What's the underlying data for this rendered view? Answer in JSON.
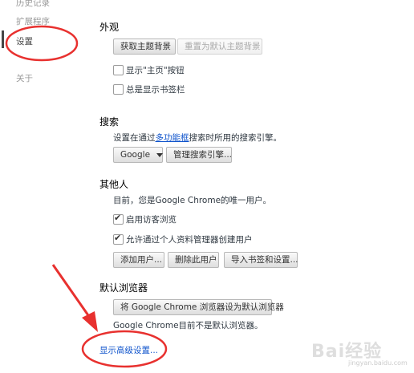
{
  "sidebar": {
    "items": [
      {
        "label": "历史记录"
      },
      {
        "label": "扩展程序"
      },
      {
        "label": "设置"
      },
      {
        "label": "关于"
      }
    ]
  },
  "appearance": {
    "title": "外观",
    "get_themes": "获取主题背景",
    "reset_theme": "重置为默认主题背景",
    "show_home": "显示\"主页\"按钮",
    "show_bookmarks": "总是显示书签栏"
  },
  "search": {
    "title": "搜索",
    "desc_prefix": "设置在通过",
    "desc_link": "多功能框",
    "desc_suffix": "搜索时所用的搜索引擎。",
    "engine": "Google",
    "manage": "管理搜索引擎..."
  },
  "people": {
    "title": "其他人",
    "desc": "目前，您是Google Chrome的唯一用户。",
    "guest": "启用访客浏览",
    "allow_create": "允许通过个人资料管理器创建用户",
    "add_user": "添加用户...",
    "delete_user": "删除此用户",
    "import": "导入书签和设置..."
  },
  "default_browser": {
    "title": "默认浏览器",
    "set_button": "将 Google Chrome 浏览器设为默认浏览器",
    "status": "Google Chrome目前不是默认浏览器。"
  },
  "advanced_link": "显示高级设置...",
  "watermark": {
    "text": "Bai经验",
    "sub": "jingyan.baidu.com"
  },
  "colors": {
    "annotation": "#e8312f",
    "link": "#1155cc"
  }
}
